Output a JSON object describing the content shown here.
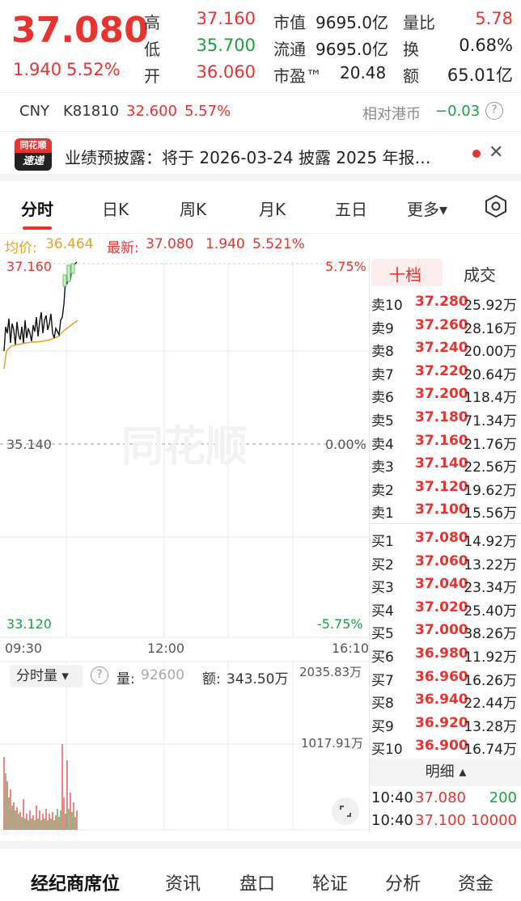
{
  "quote": {
    "price": "37.080",
    "change": "1.940",
    "change_pct": "5.52%",
    "high_label": "高",
    "high": "37.160",
    "low_label": "低",
    "low": "35.700",
    "open_label": "开",
    "open": "36.060",
    "mktcap_label": "市值",
    "mktcap": "9695.0亿",
    "float_label": "流通",
    "float": "9695.0亿",
    "pe_label": "市盈™",
    "pe": "20.48",
    "volratio_label": "量比",
    "volratio": "5.78",
    "turnover_label": "换",
    "turnover": "0.68%",
    "amount_label": "额",
    "amount": "65.01亿"
  },
  "cny": {
    "currency": "CNY",
    "code": "K81810",
    "price": "32.600",
    "pct": "5.57%",
    "relative_label": "相对港币",
    "relative_value": "−0.03",
    "help_icon": "?"
  },
  "news": {
    "logo_top": "同花顺",
    "logo_bottom": "速递",
    "text": "业绩预披露：将于 2026-03-24 披露 2025 年报…",
    "close": "✕"
  },
  "tabs": [
    {
      "label": "分时",
      "active": true
    },
    {
      "label": "日K"
    },
    {
      "label": "周K"
    },
    {
      "label": "月K"
    },
    {
      "label": "五日"
    },
    {
      "label": "更多▾"
    }
  ],
  "avg": {
    "avg_label": "均价:",
    "avg_value": "36.464",
    "latest_label": "最新:",
    "latest_value": "37.080",
    "latest_change": "1.940",
    "latest_pct": "5.521%"
  },
  "chart": {
    "price_top": "37.160",
    "price_mid": "35.140",
    "price_bot": "33.120",
    "pct_top": "5.75%",
    "pct_mid": "0.00%",
    "pct_bot": "-5.75%",
    "time_start": "09:30",
    "time_mid": "12:00",
    "time_end": "16:10",
    "watermark": "同花顺",
    "colors": {
      "price_line": "#111111",
      "avg_line": "#e8a028",
      "up": "#e8332f",
      "down": "#1e9e3e"
    }
  },
  "volume": {
    "selector": "分时量 ▾",
    "help": "?",
    "vol_label": "量:",
    "vol_value": "92600",
    "amt_label": "额:",
    "amt_value": "343.50万",
    "scale_top": "2035.83万",
    "scale_mid": "1017.91万"
  },
  "orderbook": {
    "tab_active": "十档",
    "tab_other": "成交",
    "asks": [
      {
        "label": "卖10",
        "price": "37.280",
        "vol": "25.92万"
      },
      {
        "label": "卖9",
        "price": "37.260",
        "vol": "28.16万"
      },
      {
        "label": "卖8",
        "price": "37.240",
        "vol": "20.00万"
      },
      {
        "label": "卖7",
        "price": "37.220",
        "vol": "20.64万"
      },
      {
        "label": "卖6",
        "price": "37.200",
        "vol": "118.4万"
      },
      {
        "label": "卖5",
        "price": "37.180",
        "vol": "71.34万"
      },
      {
        "label": "卖4",
        "price": "37.160",
        "vol": "21.76万"
      },
      {
        "label": "卖3",
        "price": "37.140",
        "vol": "22.56万"
      },
      {
        "label": "卖2",
        "price": "37.120",
        "vol": "19.62万"
      },
      {
        "label": "卖1",
        "price": "37.100",
        "vol": "15.56万"
      }
    ],
    "bids": [
      {
        "label": "买1",
        "price": "37.080",
        "vol": "14.92万"
      },
      {
        "label": "买2",
        "price": "37.060",
        "vol": "13.22万"
      },
      {
        "label": "买3",
        "price": "37.040",
        "vol": "23.34万"
      },
      {
        "label": "买4",
        "price": "37.020",
        "vol": "25.40万"
      },
      {
        "label": "买5",
        "price": "37.000",
        "vol": "38.26万"
      },
      {
        "label": "买6",
        "price": "36.980",
        "vol": "11.92万"
      },
      {
        "label": "买7",
        "price": "36.960",
        "vol": "16.26万"
      },
      {
        "label": "买8",
        "price": "36.940",
        "vol": "22.44万"
      },
      {
        "label": "买9",
        "price": "36.920",
        "vol": "13.28万"
      },
      {
        "label": "买10",
        "price": "36.900",
        "vol": "16.74万"
      }
    ],
    "detail_label": "明细 ▴",
    "trades": [
      {
        "time": "10:40",
        "price": "37.080",
        "vol": "200",
        "vol_color": "#1e9e3e"
      },
      {
        "time": "10:40",
        "price": "37.100",
        "vol": "10000",
        "vol_color": "#e8332f"
      }
    ]
  },
  "bottom_nav": [
    {
      "label": "经纪商席位",
      "active": true
    },
    {
      "label": "资讯"
    },
    {
      "label": "盘口"
    },
    {
      "label": "轮证"
    },
    {
      "label": "分析"
    },
    {
      "label": "资金"
    }
  ]
}
